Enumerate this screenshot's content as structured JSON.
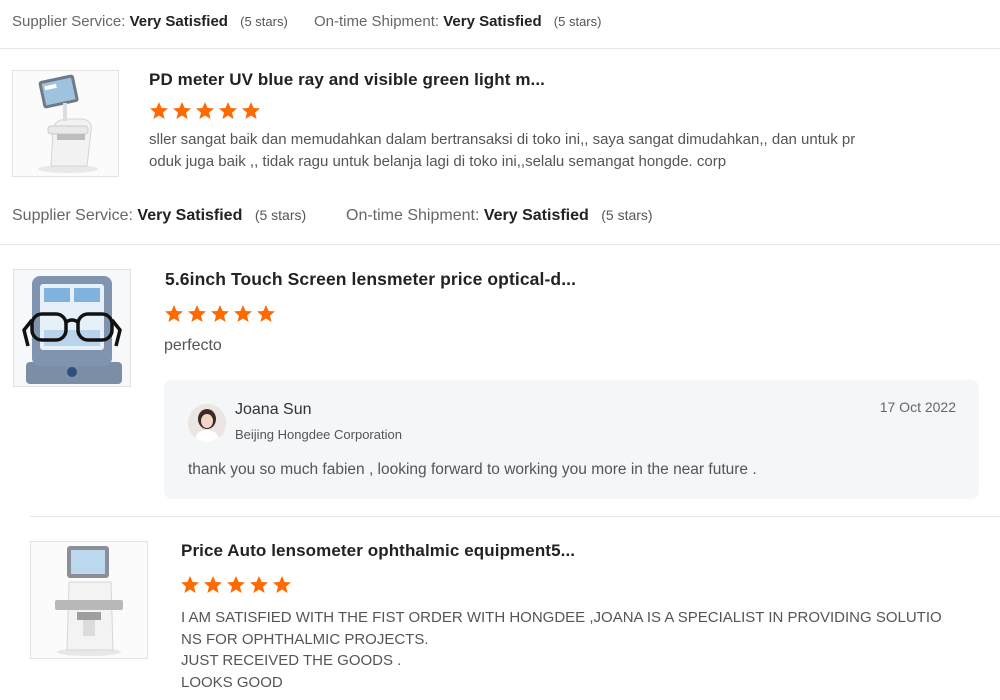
{
  "summary_rows": [
    {
      "supplier_label": "Supplier Service:",
      "supplier_value": "Very Satisfied",
      "supplier_stars": "(5 stars)",
      "shipment_label": "On-time Shipment:",
      "shipment_value": "Very Satisfied",
      "shipment_stars": "(5 stars)"
    },
    {
      "supplier_label": "Supplier Service:",
      "supplier_value": "Very Satisfied",
      "supplier_stars": "(5 stars)",
      "shipment_label": "On-time Shipment:",
      "shipment_value": "Very Satisfied",
      "shipment_stars": "(5 stars)"
    }
  ],
  "reviews": [
    {
      "product_title": "PD meter UV blue ray and visible green light m...",
      "rating": 5,
      "text_lines": [
        "sller sangat baik dan memudahkan dalam bertransaksi di toko ini,, saya sangat dimudahkan,, dan untuk  pr",
        "oduk juga baik ,, tidak ragu untuk belanja lagi di toko ini,,selalu  semangat hongde. corp"
      ]
    },
    {
      "product_title": "5.6inch Touch Screen lensmeter price optical-d...",
      "rating": 5,
      "text_lines": [
        "perfecto"
      ],
      "reply": {
        "name": "Joana Sun",
        "company": "Beijing Hongdee Corporation",
        "date": "17 Oct 2022",
        "text": "thank you so much fabien , looking forward to working you more in the near future ."
      }
    },
    {
      "product_title": "Price Auto lensometer ophthalmic equipment5...",
      "rating": 5,
      "text_lines": [
        "I AM SATISFIED WITH THE FIST ORDER WITH HONGDEE ,JOANA IS A SPECIALIST IN PROVIDING SOLUTIO",
        "NS FOR OPHTHALMIC PROJECTS.",
        "JUST RECEIVED THE GOODS .",
        "LOOKS GOOD"
      ]
    }
  ],
  "colors": {
    "star": "#ff6a00",
    "divider": "#e6e6e6",
    "reply_bg": "#f5f6f8"
  }
}
